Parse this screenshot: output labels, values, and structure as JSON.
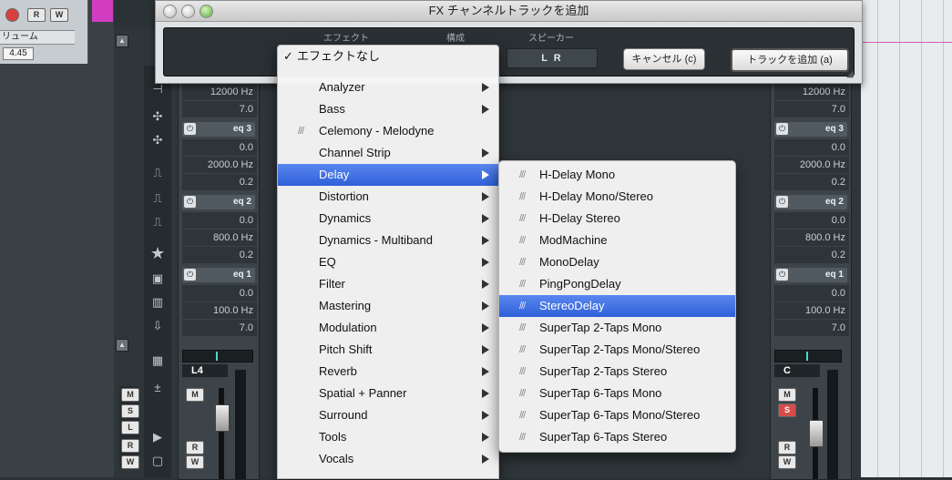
{
  "left_panel": {
    "volume_label": "リューム",
    "volume_value": "4.45",
    "btn_r": "R",
    "btn_w": "W"
  },
  "dialog": {
    "title": "FX チャンネルトラックを追加",
    "col_effect": "エフェクト",
    "col_config": "構成",
    "col_speaker": "スピーカー",
    "speaker_value": "L R",
    "cancel_label": "キャンセル (c)",
    "add_label": "トラックを追加 (a)"
  },
  "strip_left": {
    "freq_top": "12000 Hz",
    "q_top": "7.0",
    "eq3": "eq 3",
    "eq3_gain": "0.0",
    "eq3_freq": "2000.0 Hz",
    "eq3_q": "0.2",
    "eq2": "eq 2",
    "eq2_gain": "0.0",
    "eq2_freq": "800.0 Hz",
    "eq2_q": "0.2",
    "eq1": "eq 1",
    "eq1_gain": "0.0",
    "eq1_freq": "100.0 Hz",
    "eq1_q": "7.0",
    "channel": "L4",
    "m": "M",
    "r": "R",
    "w": "W"
  },
  "strip_right": {
    "freq_top": "12000 Hz",
    "q_top": "7.0",
    "eq3": "eq 3",
    "eq3_gain": "0.0",
    "eq3_freq": "2000.0 Hz",
    "eq3_q": "0.2",
    "eq2": "eq 2",
    "eq2_gain": "0.0",
    "eq2_freq": "800.0 Hz",
    "eq2_q": "0.2",
    "eq1": "eq 1",
    "eq1_gain": "0.0",
    "eq1_freq": "100.0 Hz",
    "eq1_q": "7.0",
    "channel": "C",
    "m": "M",
    "s": "S",
    "r": "R",
    "w": "W"
  },
  "menu": {
    "no_effect": "エフェクトなし",
    "check": "✓",
    "items": [
      {
        "label": "Analyzer",
        "submenu": true,
        "plugin": false
      },
      {
        "label": "Bass",
        "submenu": true,
        "plugin": false
      },
      {
        "label": "Celemony - Melodyne",
        "submenu": false,
        "plugin": true
      },
      {
        "label": "Channel Strip",
        "submenu": true,
        "plugin": false
      },
      {
        "label": "Delay",
        "submenu": true,
        "plugin": false,
        "selected": true
      },
      {
        "label": "Distortion",
        "submenu": true,
        "plugin": false
      },
      {
        "label": "Dynamics",
        "submenu": true,
        "plugin": false
      },
      {
        "label": "Dynamics - Multiband",
        "submenu": true,
        "plugin": false
      },
      {
        "label": "EQ",
        "submenu": true,
        "plugin": false
      },
      {
        "label": "Filter",
        "submenu": true,
        "plugin": false
      },
      {
        "label": "Mastering",
        "submenu": true,
        "plugin": false
      },
      {
        "label": "Modulation",
        "submenu": true,
        "plugin": false
      },
      {
        "label": "Pitch Shift",
        "submenu": true,
        "plugin": false
      },
      {
        "label": "Reverb",
        "submenu": true,
        "plugin": false
      },
      {
        "label": "Spatial + Panner",
        "submenu": true,
        "plugin": false
      },
      {
        "label": "Surround",
        "submenu": true,
        "plugin": false
      },
      {
        "label": "Tools",
        "submenu": true,
        "plugin": false
      },
      {
        "label": "Vocals",
        "submenu": true,
        "plugin": false
      }
    ]
  },
  "submenu": {
    "items": [
      {
        "label": "H-Delay Mono"
      },
      {
        "label": "H-Delay Mono/Stereo"
      },
      {
        "label": "H-Delay Stereo"
      },
      {
        "label": "ModMachine"
      },
      {
        "label": "MonoDelay"
      },
      {
        "label": "PingPongDelay"
      },
      {
        "label": "StereoDelay",
        "selected": true
      },
      {
        "label": "SuperTap 2-Taps Mono"
      },
      {
        "label": "SuperTap 2-Taps Mono/Stereo"
      },
      {
        "label": "SuperTap 2-Taps Stereo"
      },
      {
        "label": "SuperTap 6-Taps Mono"
      },
      {
        "label": "SuperTap 6-Taps Mono/Stereo"
      },
      {
        "label": "SuperTap 6-Taps Stereo"
      }
    ]
  },
  "icons": {
    "plugin_marker": "///",
    "power": "⏻",
    "star": "★"
  },
  "colors": {
    "selection": "#3a6ae0",
    "mute_active": "#d94b4b"
  }
}
